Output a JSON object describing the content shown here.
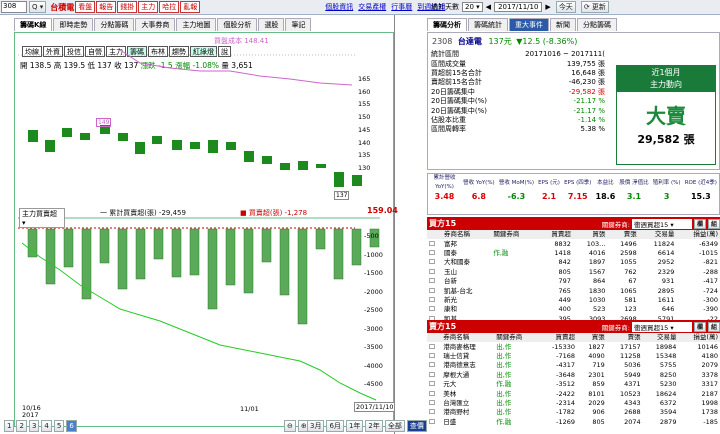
{
  "toolbar": {
    "code": "308",
    "stock": "台積電",
    "buttons": [
      "看盤",
      "報告",
      "錢掛",
      "主力",
      "哈拉",
      "亂報"
    ],
    "links": [
      "個股資訊",
      "交易產權",
      "行事曆",
      "到週過知"
    ]
  },
  "tabs": [
    "籌碼K線",
    "即時走勢",
    "分點籌碼",
    "大事券商",
    "主力地圖",
    "個股分析",
    "選股",
    "筆記"
  ],
  "periods": [
    "均線",
    "外資",
    "投信",
    "自營",
    "主力",
    "籌碼",
    "布林",
    "趨勢",
    "紅綠燈",
    "說"
  ],
  "ohlc": {
    "open": "開 138.5",
    "high": "高 139.5",
    "low": "低 137",
    "close": "收 137",
    "chg": "漲跌 -1.5",
    "pct": "漲幅 -1.08%",
    "vol": "量 3,651"
  },
  "cost_label": "買盤成本 148.41",
  "upper_y": [
    "165",
    "160",
    "155",
    "150",
    "145",
    "140",
    "135",
    "130"
  ],
  "lower_y": [
    "-500",
    "-1000",
    "-1500",
    "-2000",
    "-2500",
    "-3000",
    "-3500",
    "-4000",
    "-4500"
  ],
  "sub_select": "主力買賣超",
  "legend1": "一 累計買賣超(張) -29,459",
  "legend2": "■ 買賣超(張) -1,278",
  "side_val": "159.04",
  "dates": {
    "d1": "10/16",
    "d1y": "2017",
    "d2": "11/01",
    "d3": "2017/11/10"
  },
  "pages": [
    "1",
    "2",
    "3",
    "4",
    "5",
    "6"
  ],
  "ranges": [
    "3月",
    "6月",
    "1年",
    "2年",
    "全部",
    "查價"
  ],
  "marks": {
    "m1": "149",
    "m2": "137"
  },
  "rhead": {
    "label": "統計天數",
    "days": "20",
    "date": "2017/11/10",
    "today": "今天",
    "update": "更新"
  },
  "rtabs": [
    "籌碼分析",
    "籌碼統計",
    "重大事件",
    "新聞",
    "分點籌碼"
  ],
  "stock": {
    "code": "2308",
    "name": "台達電",
    "price": "137元",
    "chg": "▼12.5 (-8.36%)"
  },
  "stats": [
    [
      "統計區間",
      "20171016 ~ 2017111(",
      ""
    ],
    [
      "區間成交量",
      "139,755 張",
      ""
    ],
    [
      "買超前15名合計",
      "16,648 張",
      ""
    ],
    [
      "賣超前15名合計",
      "-46,230 張",
      ""
    ],
    [
      "20日籌碼集中",
      "-29,582 張",
      "red"
    ],
    [
      "20日籌碼集中(%)",
      "-21.17 %",
      "grn"
    ],
    [
      "20日籌碼集中(%)",
      "-21.17 %",
      "grn"
    ],
    [
      "佔股本比重",
      "-1.14 %",
      "grn"
    ],
    [
      "區間周轉率",
      "5.38 %",
      ""
    ]
  ],
  "box": {
    "t1": "近1個月",
    "t2": "主力動向",
    "big": "大賣",
    "num": "29,582 張"
  },
  "fin_h": [
    "累計營收 YoY(%)",
    "營收 YoY(%)",
    "營收 MoM(%)",
    "EPS (元)",
    "EPS (四季)",
    "本益比",
    "股價 淨值比",
    "殖利率 (%)",
    "ROE (近4季)"
  ],
  "fin_v": [
    "3.48",
    "6.8",
    "-6.3",
    "2.1",
    "7.15",
    "18.6",
    "3.1",
    "3",
    "15.3"
  ],
  "buy": {
    "title": "買方15",
    "ctl": "關鍵券商:",
    "sel": "衝週買超15",
    "hdr": [
      "券商名稱",
      "關鍵券商",
      "買賣超",
      "買張",
      "賣張",
      "交易量",
      "損益(萬)"
    ],
    "rows": [
      [
        "富邦",
        "",
        "8832",
        "103...",
        "1496",
        "11824",
        "-6349"
      ],
      [
        "國泰",
        "作,融",
        "1418",
        "4016",
        "2598",
        "6614",
        "-1015"
      ],
      [
        "大和國泰",
        "",
        "842",
        "1897",
        "1055",
        "2952",
        "-821"
      ],
      [
        "玉山",
        "",
        "805",
        "1567",
        "762",
        "2329",
        "-288"
      ],
      [
        "台新",
        "",
        "797",
        "864",
        "67",
        "931",
        "-417"
      ],
      [
        "凱基-台北",
        "",
        "765",
        "1830",
        "1065",
        "2895",
        "-724"
      ],
      [
        "新光",
        "",
        "449",
        "1030",
        "581",
        "1611",
        "-300"
      ],
      [
        "康和",
        "",
        "400",
        "523",
        "123",
        "646",
        "-390"
      ],
      [
        "凱基",
        "",
        "395",
        "3093",
        "2698",
        "5791",
        "-22"
      ]
    ]
  },
  "sell": {
    "title": "賣方15",
    "ctl": "關鍵券商:",
    "sel": "衝週買超15",
    "hdr": [
      "券商名稱",
      "關鍵券商",
      "買賣超",
      "買張",
      "賣張",
      "交易量",
      "損益(萬)"
    ],
    "rows": [
      [
        "港商麥格理",
        "出,作",
        "-15330",
        "1827",
        "17157",
        "18984",
        "10146"
      ],
      [
        "瑞士信貸",
        "出,作",
        "-7168",
        "4090",
        "11258",
        "15348",
        "4180"
      ],
      [
        "港商德意志",
        "出,作",
        "-4317",
        "719",
        "5036",
        "5755",
        "2079"
      ],
      [
        "摩根大通",
        "出,作",
        "-3648",
        "2301",
        "5949",
        "8250",
        "3378"
      ],
      [
        "元大",
        "作,融",
        "-3512",
        "859",
        "4371",
        "5230",
        "3317"
      ],
      [
        "美林",
        "出,作",
        "-2422",
        "8101",
        "10523",
        "18624",
        "2187"
      ],
      [
        "台灣匯立",
        "出,作",
        "-2314",
        "2029",
        "4343",
        "6372",
        "1998"
      ],
      [
        "港商野村",
        "出,作",
        "-1782",
        "906",
        "2688",
        "3594",
        "1738"
      ],
      [
        "日盛",
        "作,融",
        "-1269",
        "805",
        "2074",
        "2879",
        "-185"
      ]
    ]
  }
}
